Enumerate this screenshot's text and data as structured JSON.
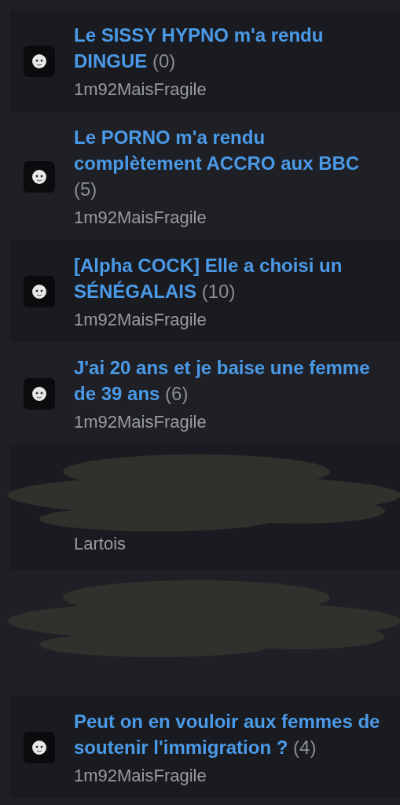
{
  "topics": [
    {
      "kind": "topic",
      "title": "Le SISSY HYPNO m'a rendu DINGUE",
      "count": "(0)",
      "author": "1m92MaisFragile"
    },
    {
      "kind": "topic",
      "title": "Le PORNO m'a rendu complètement ACCRO aux BBC",
      "count": "(5)",
      "author": "1m92MaisFragile"
    },
    {
      "kind": "topic",
      "title": "[Alpha COCK] Elle a choisi un SÉNÉGALAIS",
      "count": "(10)",
      "author": "1m92MaisFragile"
    },
    {
      "kind": "topic",
      "title": "J'ai 20 ans et je baise une femme de 39 ans",
      "count": "(6)",
      "author": "1m92MaisFragile"
    },
    {
      "kind": "redacted",
      "author": "Lartois"
    },
    {
      "kind": "redacted"
    },
    {
      "kind": "topic",
      "title": "Peut on en vouloir aux femmes de soutenir l'immigration ?",
      "count": "(4)",
      "author": "1m92MaisFragile"
    }
  ]
}
